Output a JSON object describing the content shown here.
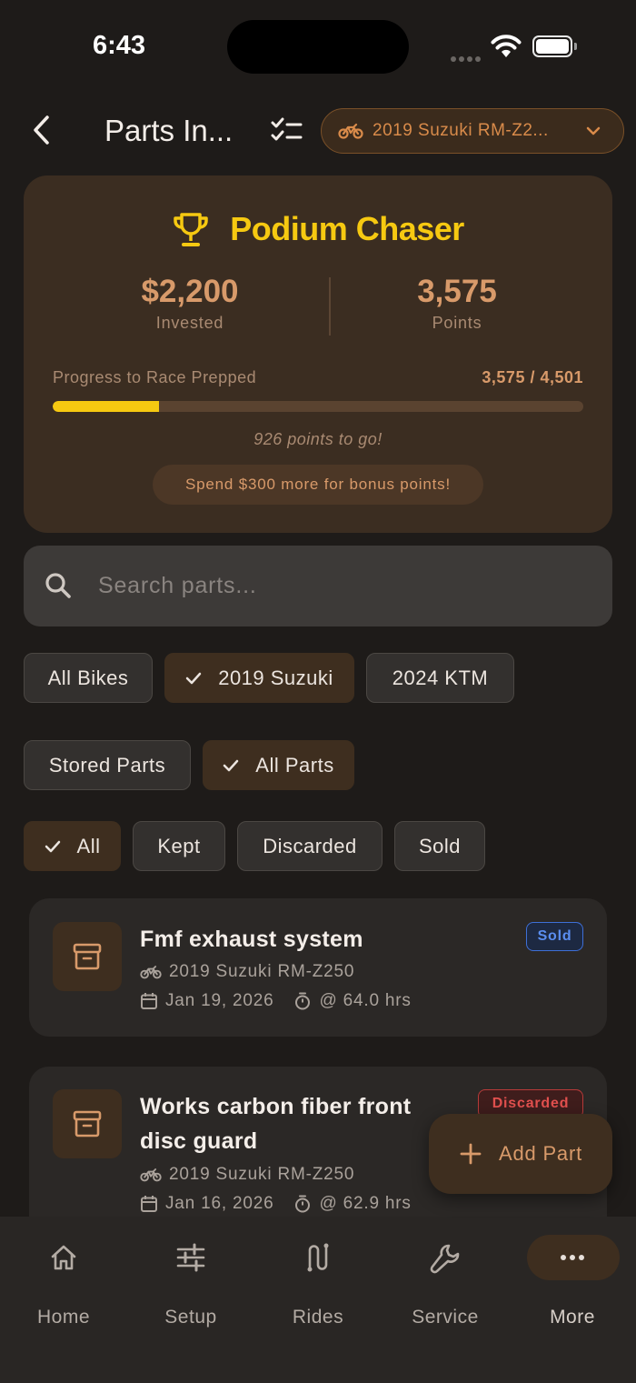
{
  "status_bar": {
    "time": "6:43"
  },
  "header": {
    "title": "Parts In...",
    "bike_selector": "2019 Suzuki RM-Z2..."
  },
  "hero": {
    "tier": "Podium Chaser",
    "invested_value": "$2,200",
    "invested_label": "Invested",
    "points_value": "3,575",
    "points_label": "Points",
    "progress_label": "Progress to Race Prepped",
    "progress_value": "3,575 / 4,501",
    "progress_fraction": 0.2,
    "to_go": "926 points to go!",
    "bonus": "Spend $300 more for bonus points!"
  },
  "search": {
    "placeholder": "Search parts..."
  },
  "filters": {
    "bikes": [
      {
        "label": "All Bikes",
        "selected": false
      },
      {
        "label": "2019 Suzuki",
        "selected": true
      },
      {
        "label": "2024 KTM",
        "selected": false
      }
    ],
    "storage": [
      {
        "label": "Stored Parts",
        "selected": false
      },
      {
        "label": "All Parts",
        "selected": true
      }
    ],
    "status": [
      {
        "label": "All",
        "selected": true
      },
      {
        "label": "Kept",
        "selected": false
      },
      {
        "label": "Discarded",
        "selected": false
      },
      {
        "label": "Sold",
        "selected": false
      }
    ]
  },
  "parts": [
    {
      "title": "Fmf exhaust system",
      "bike": "2019 Suzuki RM-Z250",
      "date": "Jan 19, 2026",
      "hours": "@ 64.0 hrs",
      "status": "Sold"
    },
    {
      "title_line1": "Works carbon fiber front",
      "title_line2": "disc guard",
      "bike": "2019 Suzuki RM-Z250",
      "date": "Jan 16, 2026",
      "hours": "@ 62.9 hrs",
      "status": "Discarded"
    }
  ],
  "fab": {
    "label": "Add Part"
  },
  "tabs": [
    {
      "label": "Home",
      "icon": "home-icon"
    },
    {
      "label": "Setup",
      "icon": "sliders-icon"
    },
    {
      "label": "Rides",
      "icon": "route-icon"
    },
    {
      "label": "Service",
      "icon": "wrench-icon"
    },
    {
      "label": "More",
      "icon": "more-icon"
    }
  ],
  "colors": {
    "background": "#1e1b19",
    "accent": "#d89a6a",
    "gold": "#f6c911",
    "sold": "#5b8ef0",
    "discarded": "#e2504e"
  }
}
